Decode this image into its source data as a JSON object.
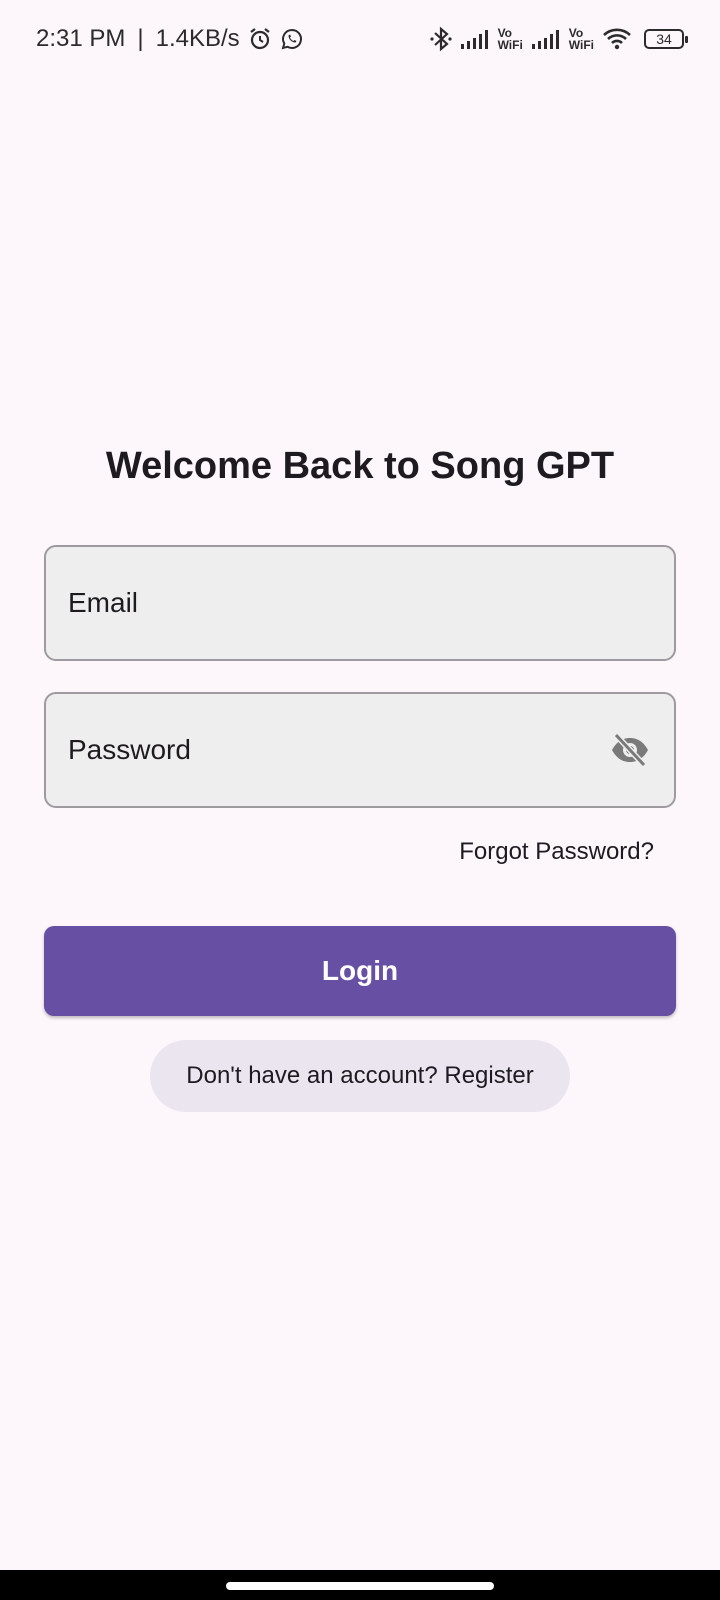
{
  "status_bar": {
    "time": "2:31 PM",
    "separator": "|",
    "net_speed": "1.4KB/s",
    "vo_top": "Vo",
    "vo_bottom": "WiFi",
    "battery": "34"
  },
  "login": {
    "title": "Welcome Back to Song GPT",
    "email_placeholder": "Email",
    "password_placeholder": "Password",
    "forgot_label": "Forgot Password?",
    "login_label": "Login",
    "register_label": "Don't have an account? Register"
  },
  "colors": {
    "background": "#fdf7fb",
    "primary": "#6750a4",
    "field_bg": "#eeeeee",
    "tonal_bg": "#ebe5f0"
  },
  "icons": [
    "alarm-icon",
    "whatsapp-icon",
    "bluetooth-icon",
    "signal-icon",
    "wifi-icon",
    "battery-icon",
    "visibility-off-icon"
  ]
}
